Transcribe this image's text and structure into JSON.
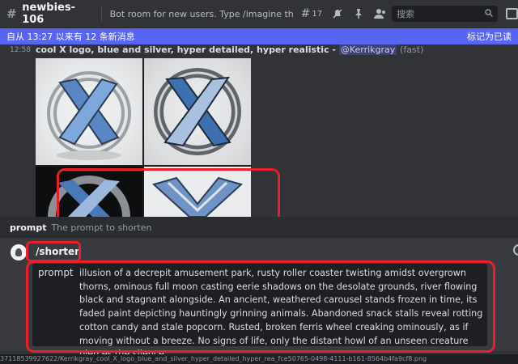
{
  "header": {
    "channel_name": "newbies-106",
    "topic": "Bot room for new users. Type /imagine then desc...",
    "thread_count": "17",
    "search_placeholder": "搜索"
  },
  "banner": {
    "new_messages": "自从 13:27 以来有 12 条新消息",
    "mark_read": "标记为已读"
  },
  "message": {
    "timestamp": "12:58",
    "prompt_text": "cool X logo, blue and silver, hyper detailed, hyper realistic -",
    "mention": "@Kerrikgray",
    "mode": "(fast)"
  },
  "hint": {
    "option_name": "prompt",
    "option_desc": "The prompt to shorten"
  },
  "composer": {
    "command": "/shorten",
    "param_name": "prompt",
    "param_value": "illusion of a decrepit amusement park, rusty roller coaster twisting amidst overgrown thorns, ominous full moon casting eerie shadows on the desolate grounds, river flowing black and stagnant alongside. An ancient, weathered carousel stands frozen in time, its faded paint depicting hauntingly grinning animals. Abandoned snack stalls reveal rotting cotton candy and stale popcorn. Rusted, broken ferris wheel creaking ominously, as if moving without a breeze. No signs of life, only the distant howl of an unseen creature pierces the silence."
  },
  "status_bar": {
    "url": "37118539927622/Kerrikgray_cool_X_logo_blue_and_silver_hyper_detailed_hyper_rea_fce50765-0498-4111-b161-8564b4fa9cf8.png"
  },
  "colors": {
    "accent": "#5865f2",
    "annotation_red": "#e8202a",
    "background": "#313338"
  }
}
